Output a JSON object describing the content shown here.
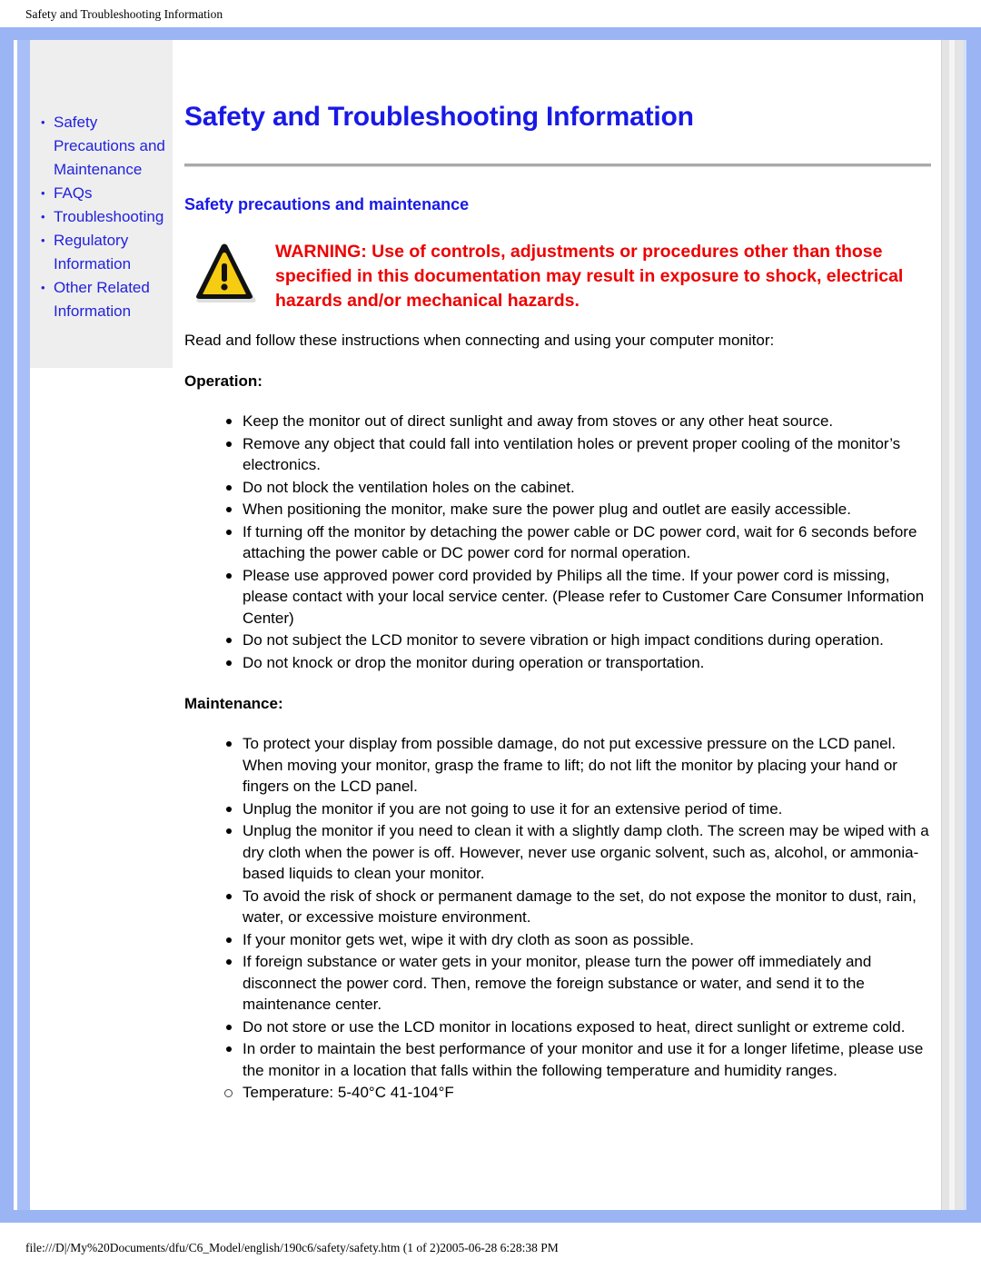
{
  "print": {
    "header": "Safety and Troubleshooting Information",
    "footer": "file:///D|/My%20Documents/dfu/C6_Model/english/190c6/safety/safety.htm (1 of 2)2005-06-28 6:28:38 PM"
  },
  "colors": {
    "frame_blue": "#9AB4F4",
    "link_blue": "#2222DD",
    "heading_blue": "#1919E6",
    "warning_red": "#EE0000",
    "sidebar_bg": "#EEEEEE",
    "warning_icon_fill": "#F5CC11"
  },
  "sidebar": {
    "items": [
      {
        "label": "Safety Precautions and Maintenance"
      },
      {
        "label": "FAQs"
      },
      {
        "label": "Troubleshooting"
      },
      {
        "label": "Regulatory Information"
      },
      {
        "label": "Other Related Information"
      }
    ]
  },
  "main": {
    "title": "Safety and Troubleshooting Information",
    "subtitle": "Safety precautions and maintenance",
    "warning": "WARNING: Use of controls, adjustments or procedures other than those specified in this documentation may result in exposure to shock, electrical hazards and/or mechanical hazards.",
    "intro": "Read and follow these instructions when connecting and using your computer monitor:",
    "operation_heading": "Operation:",
    "operation_items": [
      "Keep the monitor out of direct sunlight and away from stoves or any other heat source.",
      "Remove any object that could fall into ventilation holes or prevent proper cooling of the monitor’s electronics.",
      "Do not block the ventilation holes on the cabinet.",
      "When positioning the monitor, make sure the power plug and outlet are easily accessible.",
      "If turning off the monitor by detaching the power cable or DC power cord, wait for 6 seconds before attaching the power cable or DC power cord for normal operation.",
      "Please use approved power cord provided by Philips all the time. If your power cord is missing, please contact with your local service center. (Please refer to Customer Care Consumer Information Center)",
      "Do not subject the LCD monitor to severe vibration or high impact conditions during operation.",
      "Do not knock or drop the monitor during operation or transportation."
    ],
    "maintenance_heading": "Maintenance:",
    "maintenance_items": [
      "To protect your display from possible damage, do not put excessive pressure on the LCD panel. When moving your monitor, grasp the frame to lift; do not lift the monitor by placing your hand or fingers on the LCD panel.",
      "Unplug the monitor if you are not going to use it for an extensive period of time.",
      "Unplug the monitor if you need to clean it with a slightly damp cloth. The screen may be wiped with a dry cloth when the power is off. However, never use organic solvent, such as, alcohol, or ammonia-based liquids to clean your monitor.",
      "To avoid the risk of shock or permanent damage to the set, do not expose the monitor to dust, rain, water, or excessive moisture environment.",
      "If your monitor gets wet, wipe it with dry cloth as soon as possible.",
      "If foreign substance or water gets in your monitor, please turn the power off immediately and disconnect the power cord. Then, remove the foreign substance or water, and send it to the maintenance center.",
      "Do not store or use the LCD monitor in locations exposed to heat, direct sunlight or extreme cold.",
      "In order to maintain the best performance of your monitor and use it for a longer lifetime, please use the monitor in a location that falls within the following temperature and humidity ranges."
    ],
    "range_items": [
      "Temperature: 5-40°C 41-104°F"
    ]
  }
}
